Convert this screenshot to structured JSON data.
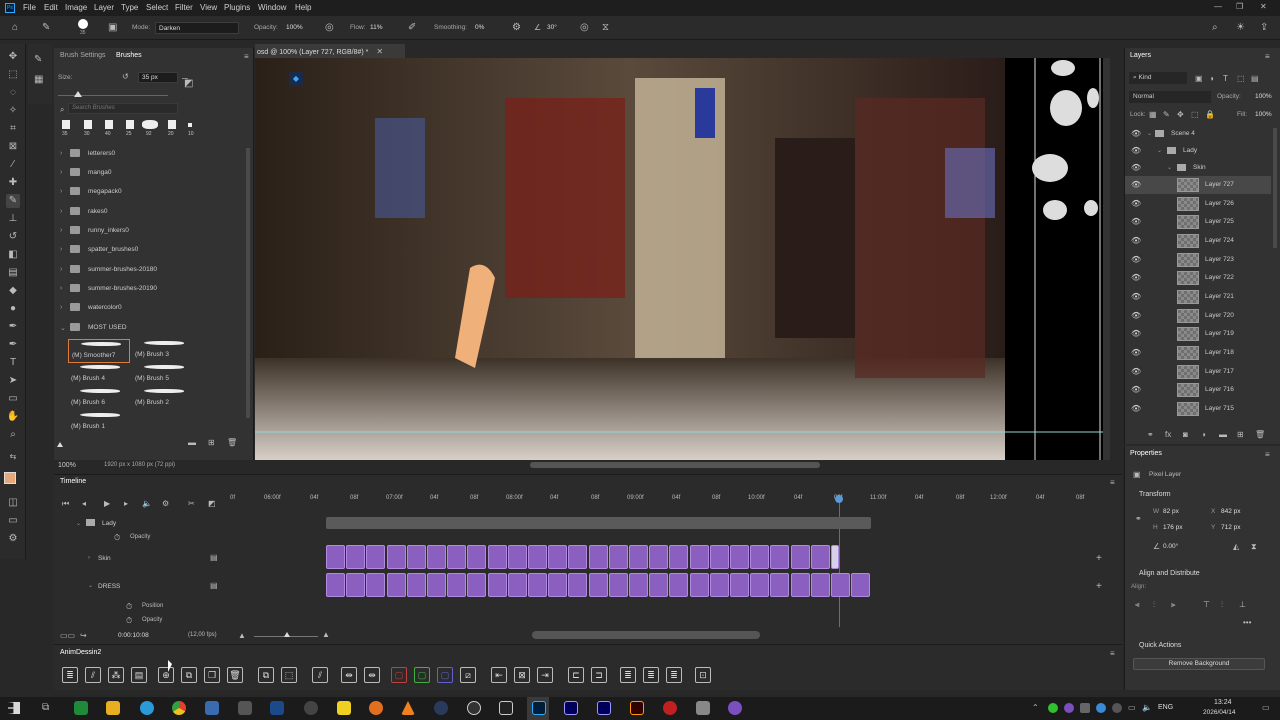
{
  "menu": [
    "File",
    "Edit",
    "Image",
    "Layer",
    "Type",
    "Select",
    "Filter",
    "View",
    "Plugins",
    "Window",
    "Help"
  ],
  "options": {
    "mode_label": "Mode:",
    "mode_value": "Darken",
    "opacity_label": "Opacity:",
    "opacity_value": "100%",
    "flow_label": "Flow:",
    "flow_value": "11%",
    "smoothing_label": "Smoothing:",
    "smoothing_value": "0%",
    "angle_value": "30°",
    "brush_size_small": "35"
  },
  "brush_panel": {
    "tab_settings": "Brush Settings",
    "tab_brushes": "Brushes",
    "size_label": "Size:",
    "size_value": "35 px",
    "search_placeholder": "Search Brushes",
    "presets": [
      "35",
      "30",
      "40",
      "25",
      "92",
      "20",
      "10"
    ],
    "folders": [
      "letterers0",
      "manga0",
      "megapack0",
      "rakes0",
      "runny_inkers0",
      "spatter_brushes0",
      "summer-brushes-20180",
      "summer-brushes-20190",
      "watercolor0",
      "MOST USED"
    ],
    "most_used": [
      "(M) Smoother7",
      "(M) Brush 3",
      "(M) Brush 4",
      "(M) Brush 5",
      "(M) Brush 6",
      "(M) Brush 2",
      "(M) Brush 1"
    ]
  },
  "document": {
    "tab_title": "osd @ 100% (Layer 727, RGB/8#) *"
  },
  "status": {
    "zoom": "100%",
    "dims": "1920 px x 1080 px (72 ppi)"
  },
  "layers": {
    "title": "Layers",
    "filter": "Kind",
    "blend": "Normal",
    "opacity_label": "Opacity:",
    "opacity_value": "100%",
    "lock_label": "Lock:",
    "fill_label": "Fill:",
    "fill_value": "100%",
    "groups": [
      "Scene 4",
      "Lady",
      "Skin"
    ],
    "items": [
      "Layer 727",
      "Layer 726",
      "Layer 725",
      "Layer 724",
      "Layer 723",
      "Layer 722",
      "Layer 721",
      "Layer 720",
      "Layer 719",
      "Layer 718",
      "Layer 717",
      "Layer 716",
      "Layer 715"
    ]
  },
  "properties": {
    "title": "Properties",
    "kind": "Pixel Layer",
    "transform": "Transform",
    "w_label": "W",
    "w_value": "82 px",
    "x_label": "X",
    "x_value": "842 px",
    "h_label": "H",
    "h_value": "176 px",
    "y_label": "Y",
    "y_value": "712 px",
    "angle_value": "0.00°",
    "align_title": "Align and Distribute",
    "align_label": "Align:",
    "quick_actions": "Quick Actions",
    "remove_bg": "Remove Background"
  },
  "timeline": {
    "title": "Timeline",
    "ruler": [
      "0f",
      "06:00f",
      "04f",
      "08f",
      "07:00f",
      "04f",
      "08f",
      "08:00f",
      "04f",
      "08f",
      "09:00f",
      "04f",
      "08f",
      "10:00f",
      "04f",
      "08f",
      "11:00f",
      "04f",
      "08f",
      "12:00f",
      "04f",
      "08f"
    ],
    "tracks": {
      "lady": "Lady",
      "opacity": "Opacity",
      "skin": "Skin",
      "dress": "DRESS",
      "position": "Position",
      "opacity2": "Opacity"
    },
    "timecode": "0:00:10:08",
    "fps": "(12,00 fps)"
  },
  "anim_panel": {
    "title": "AnimDessin2"
  },
  "taskbar": {
    "lang": "ENG",
    "time": "13:24",
    "date": "2026/04/14"
  }
}
